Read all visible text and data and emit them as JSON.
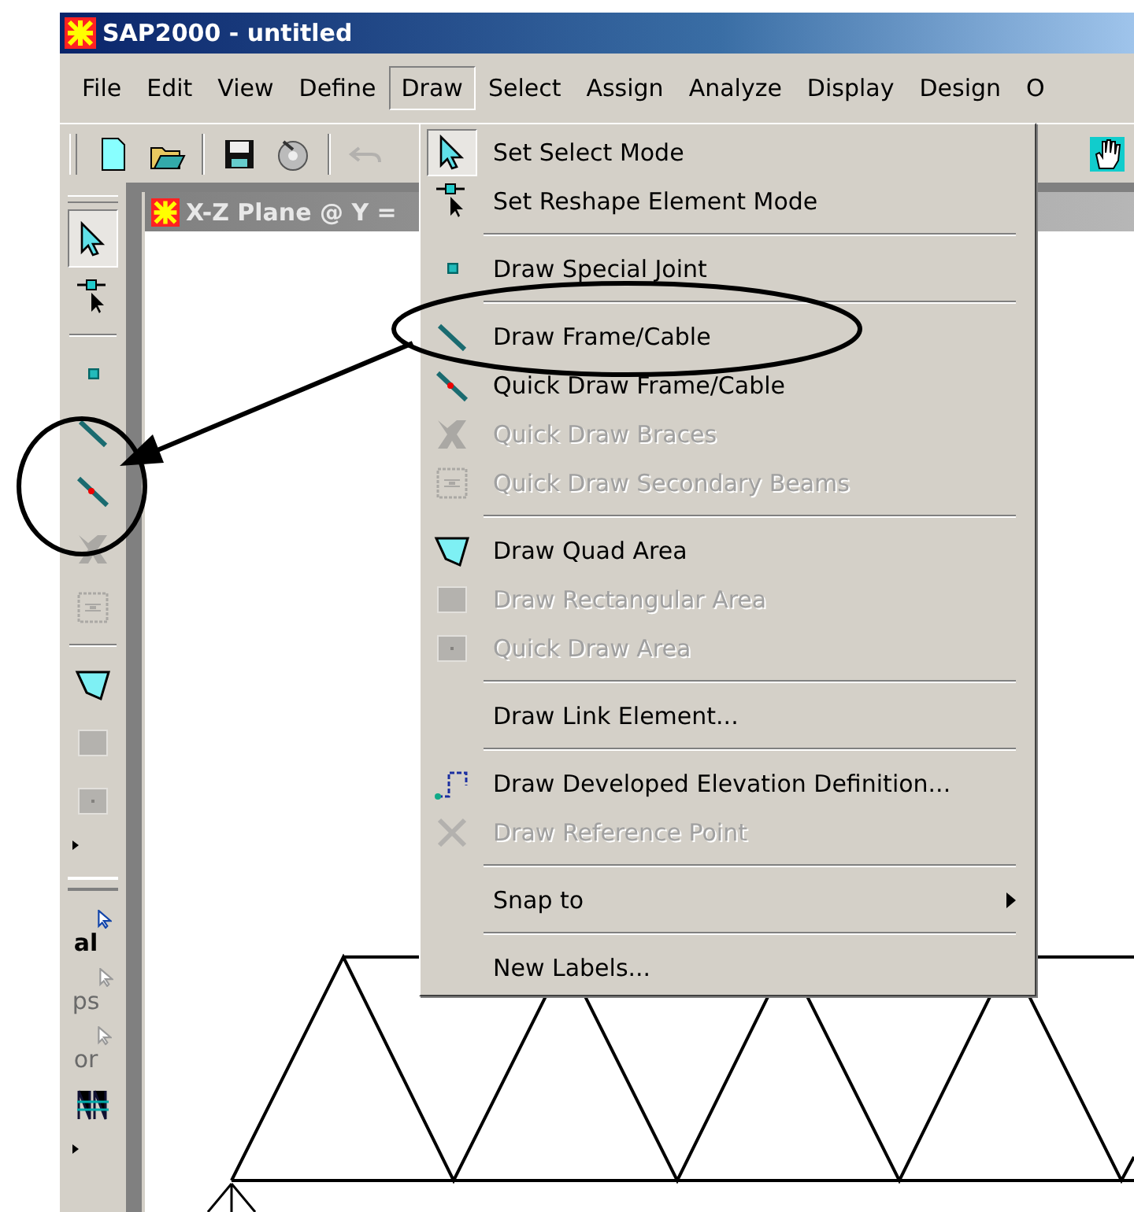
{
  "window": {
    "title": "SAP2000 - untitled"
  },
  "menu_bar": [
    {
      "label": "File",
      "selected": false
    },
    {
      "label": "Edit",
      "selected": false
    },
    {
      "label": "View",
      "selected": false
    },
    {
      "label": "Define",
      "selected": false
    },
    {
      "label": "Draw",
      "selected": true
    },
    {
      "label": "Select",
      "selected": false
    },
    {
      "label": "Assign",
      "selected": false
    },
    {
      "label": "Analyze",
      "selected": false
    },
    {
      "label": "Display",
      "selected": false
    },
    {
      "label": "Design",
      "selected": false
    },
    {
      "label": "O",
      "selected": false
    }
  ],
  "toolbar": [
    {
      "disabled": false
    },
    {
      "disabled": false
    },
    {
      "disabled": false
    },
    {
      "disabled": false
    },
    {
      "disabled": true
    },
    {
      "disabled": false
    }
  ],
  "draw_menu": [
    {
      "kind": "item",
      "label": "Set Select Mode",
      "disabled": false,
      "checked": true,
      "submenu": false
    },
    {
      "kind": "item",
      "label": "Set Reshape Element Mode",
      "disabled": false,
      "checked": false,
      "submenu": false
    },
    {
      "kind": "separator"
    },
    {
      "kind": "item",
      "label": "Draw Special Joint",
      "disabled": false,
      "checked": false,
      "submenu": false
    },
    {
      "kind": "separator"
    },
    {
      "kind": "item",
      "label": "Draw Frame/Cable",
      "disabled": false,
      "checked": false,
      "submenu": false
    },
    {
      "kind": "item",
      "label": "Quick Draw Frame/Cable",
      "disabled": false,
      "checked": false,
      "submenu": false
    },
    {
      "kind": "item",
      "label": "Quick Draw Braces",
      "disabled": true,
      "checked": false,
      "submenu": false
    },
    {
      "kind": "item",
      "label": "Quick Draw Secondary Beams",
      "disabled": true,
      "checked": false,
      "submenu": false
    },
    {
      "kind": "separator"
    },
    {
      "kind": "item",
      "label": "Draw Quad Area",
      "disabled": false,
      "checked": false,
      "submenu": false
    },
    {
      "kind": "item",
      "label": "Draw Rectangular Area",
      "disabled": true,
      "checked": false,
      "submenu": false
    },
    {
      "kind": "item",
      "label": "Quick Draw Area",
      "disabled": true,
      "checked": false,
      "submenu": false
    },
    {
      "kind": "separator"
    },
    {
      "kind": "item",
      "label": "Draw Link Element...",
      "disabled": false,
      "checked": false,
      "submenu": false
    },
    {
      "kind": "separator"
    },
    {
      "kind": "item",
      "label": "Draw Developed Elevation Definition...",
      "disabled": false,
      "checked": false,
      "submenu": false
    },
    {
      "kind": "item",
      "label": "Draw Reference Point",
      "disabled": true,
      "checked": false,
      "submenu": false
    },
    {
      "kind": "separator"
    },
    {
      "kind": "item",
      "label": "Snap to",
      "disabled": false,
      "checked": false,
      "submenu": true
    },
    {
      "kind": "separator"
    },
    {
      "kind": "item",
      "label": "New Labels...",
      "disabled": false,
      "checked": false,
      "submenu": false
    }
  ],
  "left_toolbar": [
    {
      "kind": "tool",
      "selected": true,
      "disabled": false
    },
    {
      "kind": "tool",
      "selected": false,
      "disabled": false
    },
    {
      "kind": "separator"
    },
    {
      "kind": "tool",
      "selected": false,
      "disabled": false
    },
    {
      "kind": "tool",
      "selected": false,
      "disabled": false
    },
    {
      "kind": "tool",
      "selected": false,
      "disabled": false
    },
    {
      "kind": "tool",
      "selected": false,
      "disabled": true
    },
    {
      "kind": "tool",
      "selected": false,
      "disabled": true
    },
    {
      "kind": "separator"
    },
    {
      "kind": "tool",
      "selected": false,
      "disabled": false
    },
    {
      "kind": "tool",
      "selected": false,
      "disabled": true
    },
    {
      "kind": "tool",
      "selected": false,
      "disabled": true
    },
    {
      "kind": "overflow"
    },
    {
      "kind": "grip"
    },
    {
      "kind": "text_tool",
      "label": "al",
      "selected": false,
      "disabled": false
    },
    {
      "kind": "text_tool",
      "label": "ps",
      "selected": false,
      "disabled": true
    },
    {
      "kind": "text_tool",
      "label": "or",
      "selected": false,
      "disabled": true
    },
    {
      "kind": "tool",
      "selected": false,
      "disabled": false
    },
    {
      "kind": "overflow"
    }
  ],
  "view_window": {
    "title": "X-Z Plane @ Y ="
  }
}
